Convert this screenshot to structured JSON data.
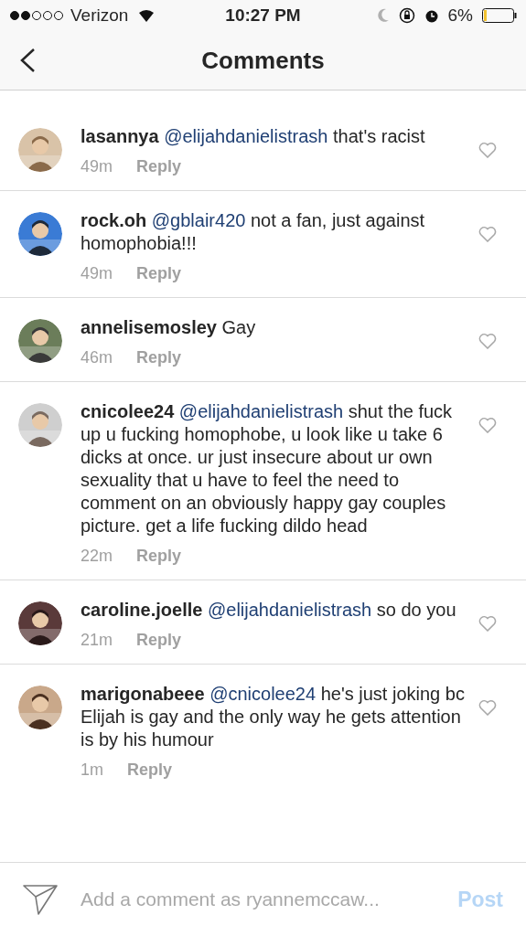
{
  "status_bar": {
    "carrier": "Verizon",
    "time": "10:27 PM",
    "battery": "6%"
  },
  "header": {
    "title": "Comments"
  },
  "comments": [
    {
      "user": "lasannya",
      "mention": "@elijahdanielistrash",
      "text": "that's racist",
      "time": "49m",
      "reply": "Reply"
    },
    {
      "user": "rock.oh",
      "mention": "@gblair420",
      "text": "not a fan, just against homophobia!!!",
      "time": "49m",
      "reply": "Reply"
    },
    {
      "user": "annelisemosley",
      "text": "Gay",
      "time": "46m",
      "reply": "Reply"
    },
    {
      "user": "cnicolee24",
      "mention": "@elijahdanielistrash",
      "text": "shut the fuck up u fucking homophobe, u look like u take 6 dicks at once. ur just insecure about ur own sexuality that u have to feel the need to comment on an obviously happy gay couples picture. get a life fucking dildo head",
      "time": "22m",
      "reply": "Reply"
    },
    {
      "user": "caroline.joelle",
      "mention": "@elijahdanielistrash",
      "text": "so do you",
      "time": "21m",
      "reply": "Reply"
    },
    {
      "user": "marigonabeee",
      "mention": "@cnicolee24",
      "text": "he's just joking bc Elijah is gay and the only way he gets attention is by his humour",
      "time": "1m",
      "reply": "Reply"
    }
  ],
  "composer": {
    "placeholder": "Add a comment as ryannemccaw...",
    "post": "Post"
  }
}
